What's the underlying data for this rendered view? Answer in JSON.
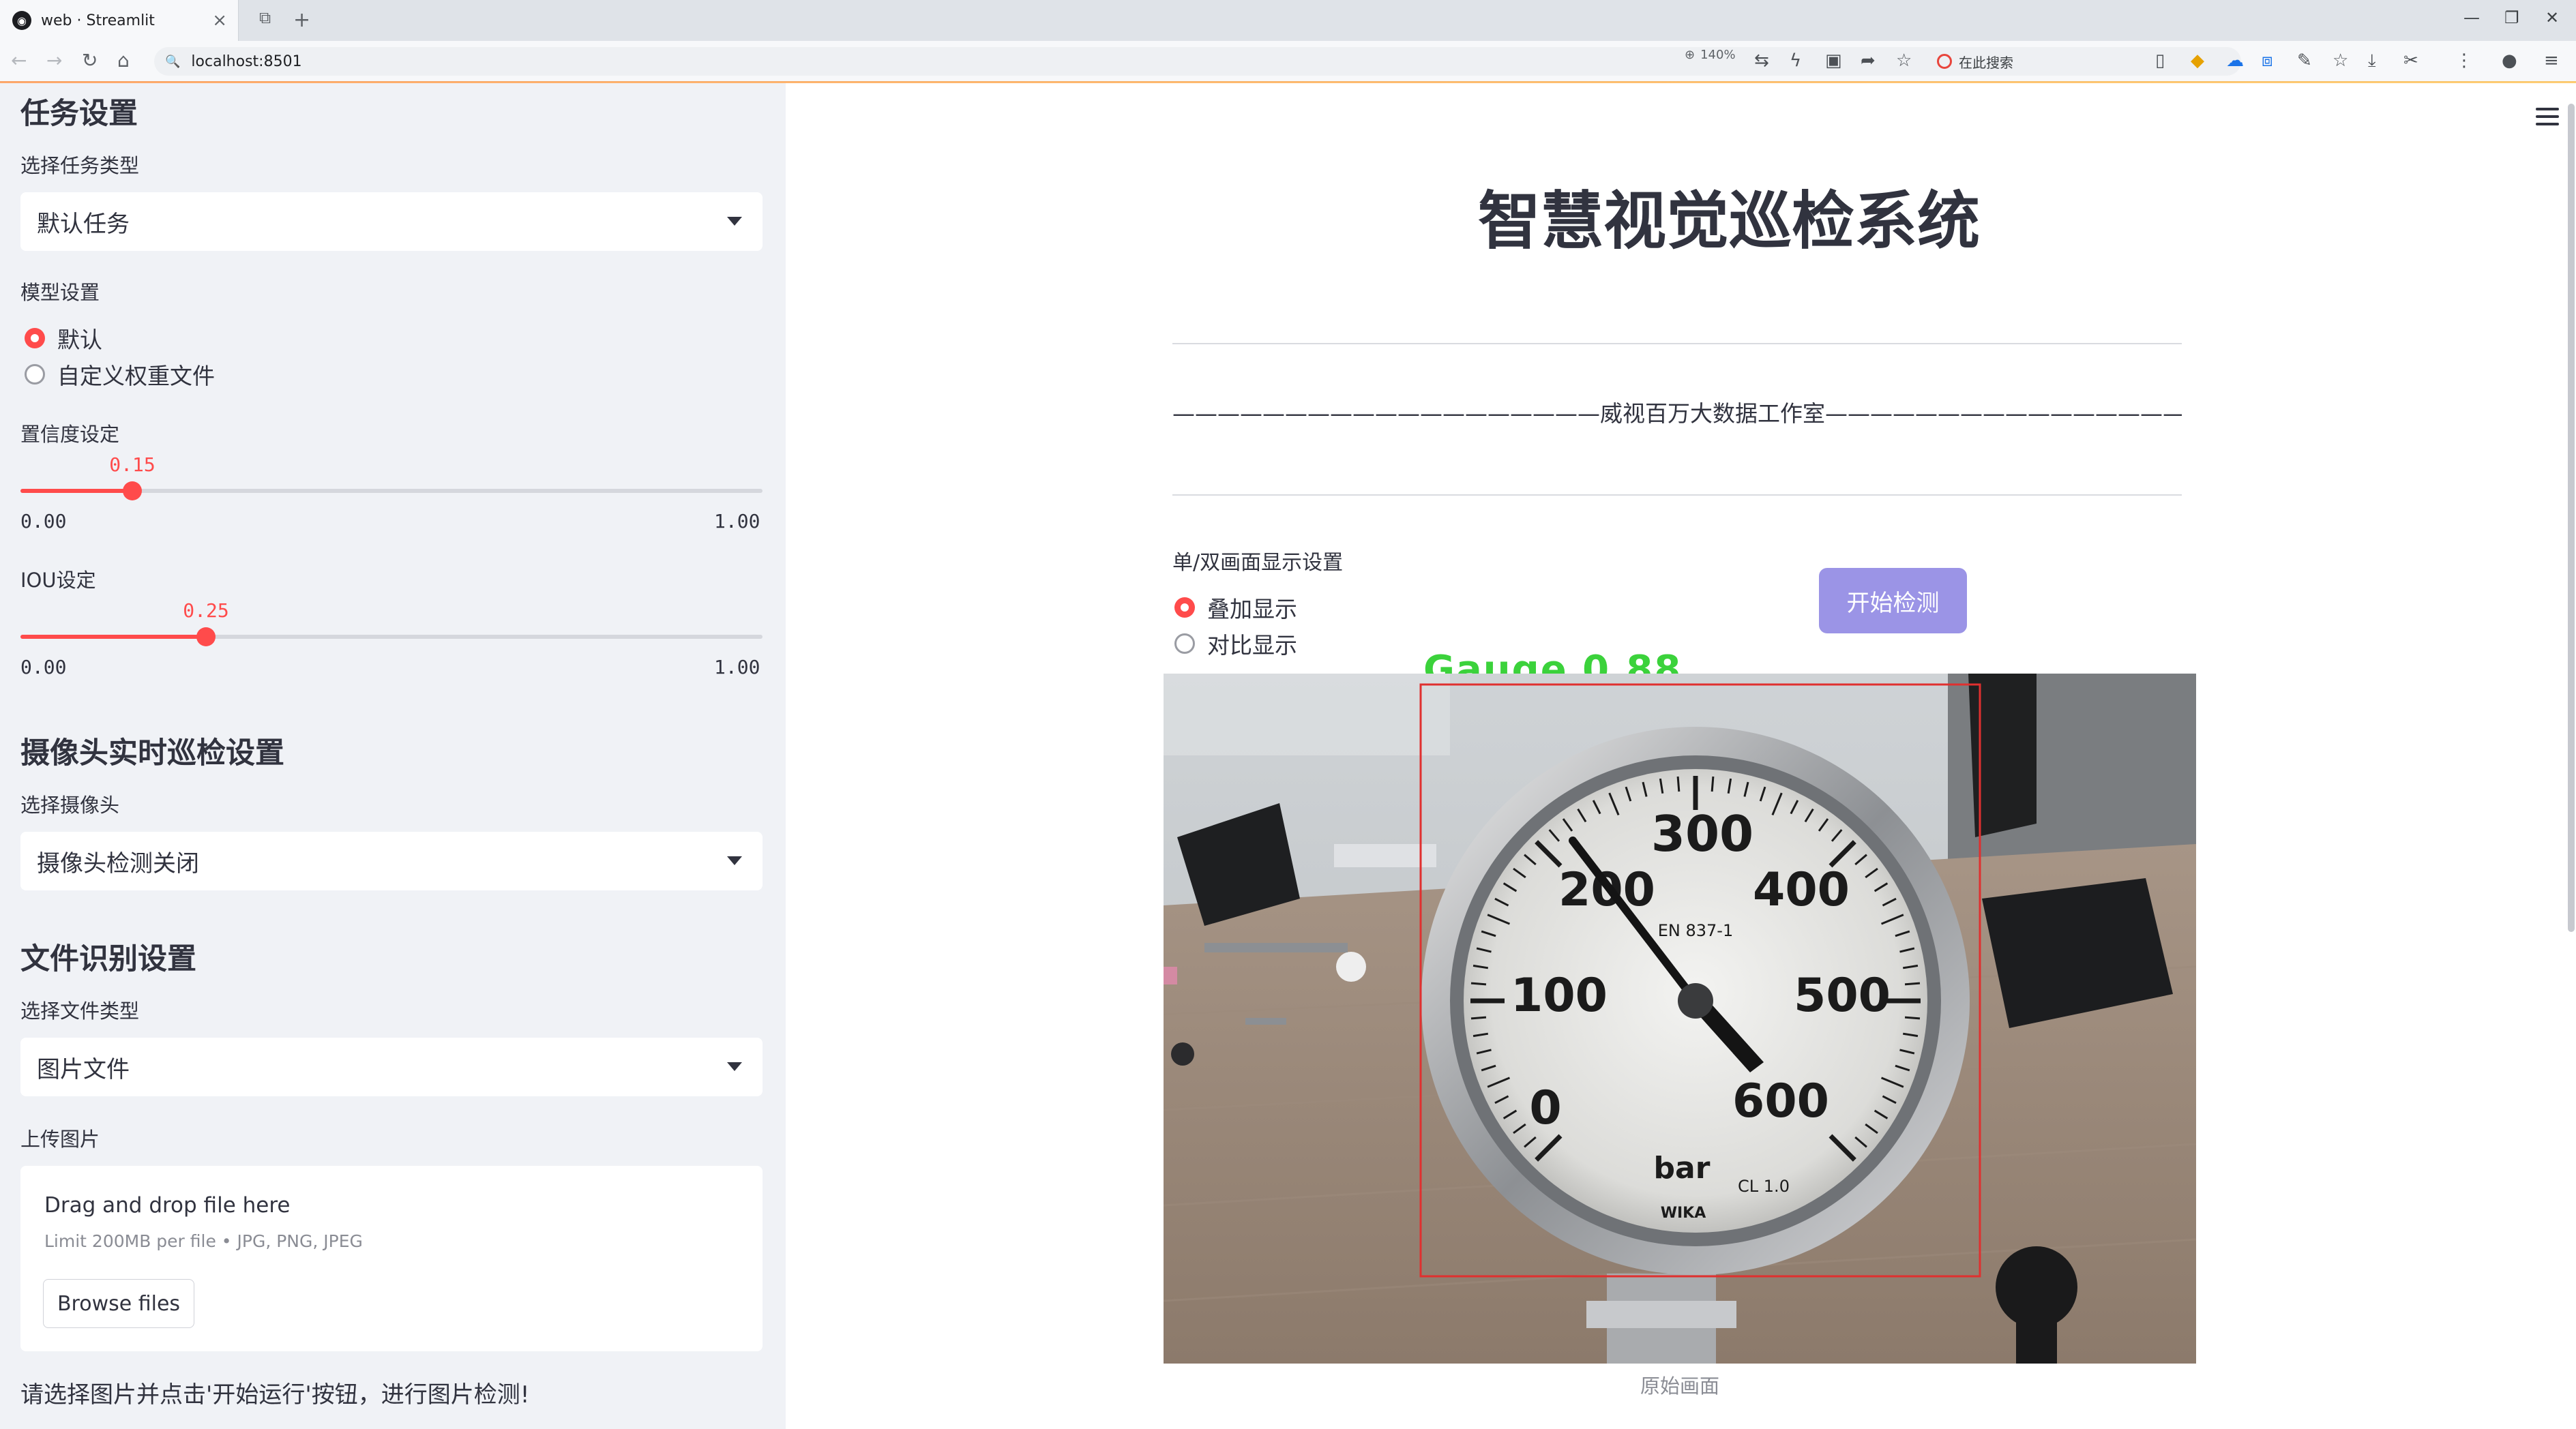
{
  "browser": {
    "tab_title": "web · Streamlit",
    "url": "localhost:8501",
    "zoom": "140%",
    "search_placeholder": "在此搜索"
  },
  "sidebar": {
    "task_heading": "任务设置",
    "task_type_label": "选择任务类型",
    "task_type_value": "默认任务",
    "model_label": "模型设置",
    "model_options": [
      "默认",
      "自定义权重文件"
    ],
    "model_selected": "默认",
    "confidence": {
      "label": "置信度设定",
      "value": "0.15",
      "min": "0.00",
      "max": "1.00",
      "fraction": 0.15
    },
    "iou": {
      "label": "IOU设定",
      "value": "0.25",
      "min": "0.00",
      "max": "1.00",
      "fraction": 0.25
    },
    "camera_heading": "摄像头实时巡检设置",
    "camera_label": "选择摄像头",
    "camera_value": "摄像头检测关闭",
    "file_heading": "文件识别设置",
    "file_type_label": "选择文件类型",
    "file_type_value": "图片文件",
    "upload_label": "上传图片",
    "upload_drop": "Drag and drop file here",
    "upload_limit": "Limit 200MB per file • JPG, PNG, JPEG",
    "upload_button": "Browse files",
    "hint": "请选择图片并点击'开始运行'按钮，进行图片检测!"
  },
  "main": {
    "title": "智慧视觉巡检系统",
    "credit": "———————————————————威视百万大数据工作室————————————————————",
    "display_mode_label": "单/双画面显示设置",
    "display_options": [
      "叠加显示",
      "对比显示"
    ],
    "display_selected": "叠加显示",
    "start_button": "开始检测",
    "detection_label": "Gauge 0.88",
    "image_caption": "原始画面",
    "gauge_numbers": [
      "0",
      "100",
      "200",
      "300",
      "400",
      "500",
      "600"
    ],
    "gauge_unit": "bar",
    "gauge_standard": "EN 837-1",
    "gauge_class": "CL 1.0",
    "gauge_brand": "WIKA"
  },
  "colors": {
    "accent": "#ff4b4b",
    "sidebar_bg": "#f0f2f6",
    "button": "#9b94e6",
    "detection_box": "#e0302f",
    "detection_text": "#3bd23b"
  }
}
